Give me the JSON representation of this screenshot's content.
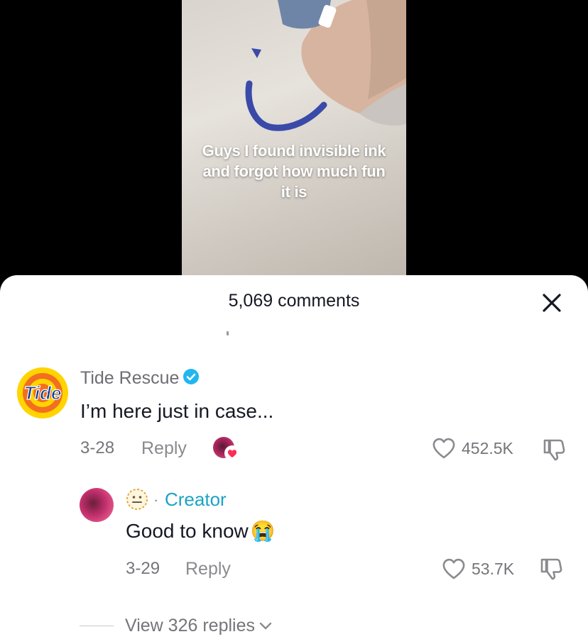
{
  "video": {
    "caption_lines": [
      "Guys I found invisible ink",
      "and forgot how much fun",
      "it is"
    ]
  },
  "sheet": {
    "comment_count_label": "5,069 comments"
  },
  "comments": [
    {
      "username": "Tide Rescue",
      "text": "I’m here just in case...",
      "date": "3-28",
      "reply_label": "Reply",
      "likes": "452.5K",
      "avatar_brand": "Tide",
      "verified": true
    }
  ],
  "reply": {
    "creator_label": "Creator",
    "separator": "·",
    "text": "Good to know",
    "emoji": "😭",
    "date": "3-29",
    "reply_label": "Reply",
    "likes": "53.7K"
  },
  "view_replies_label": "View 326 replies",
  "colors": {
    "accent_creator": "#1aa3c6",
    "verified_blue": "#20b7f0",
    "heart_red": "#fe2c55",
    "tide_orange": "#f26f21",
    "tide_yellow": "#ffd400"
  }
}
